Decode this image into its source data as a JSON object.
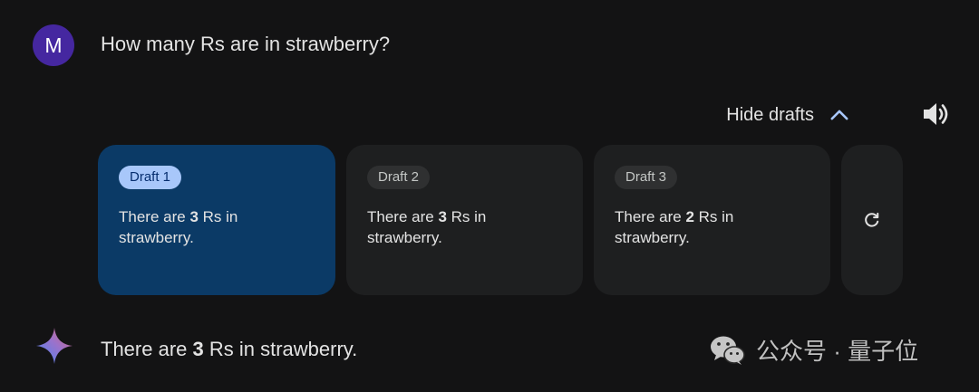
{
  "prompt": {
    "avatar_letter": "M",
    "text": "How many Rs are in strawberry?"
  },
  "drafts_header": {
    "toggle_label": "Hide drafts",
    "toggle_icon": "chevron-up-icon",
    "audio_icon": "speaker-icon"
  },
  "drafts": [
    {
      "label": "Draft 1",
      "text_before": "There are ",
      "count": "3",
      "text_after": " Rs in strawberry.",
      "selected": true
    },
    {
      "label": "Draft 2",
      "text_before": "There are ",
      "count": "3",
      "text_after": " Rs in strawberry.",
      "selected": false
    },
    {
      "label": "Draft 3",
      "text_before": "There are ",
      "count": "2",
      "text_after": " Rs in strawberry.",
      "selected": false
    }
  ],
  "regenerate_icon": "refresh-icon",
  "response": {
    "icon": "gemini-sparkle-icon",
    "text_before": "There are ",
    "count": "3",
    "text_after": " Rs in strawberry."
  },
  "watermark": {
    "text": "公众号 · 量子位"
  },
  "colors": {
    "background": "#131314",
    "card": "#1e1f20",
    "selected_card": "#0b3a66",
    "selected_chip": "#a8c7fa",
    "avatar": "#4527a0",
    "accent": "#a8c7fa"
  }
}
